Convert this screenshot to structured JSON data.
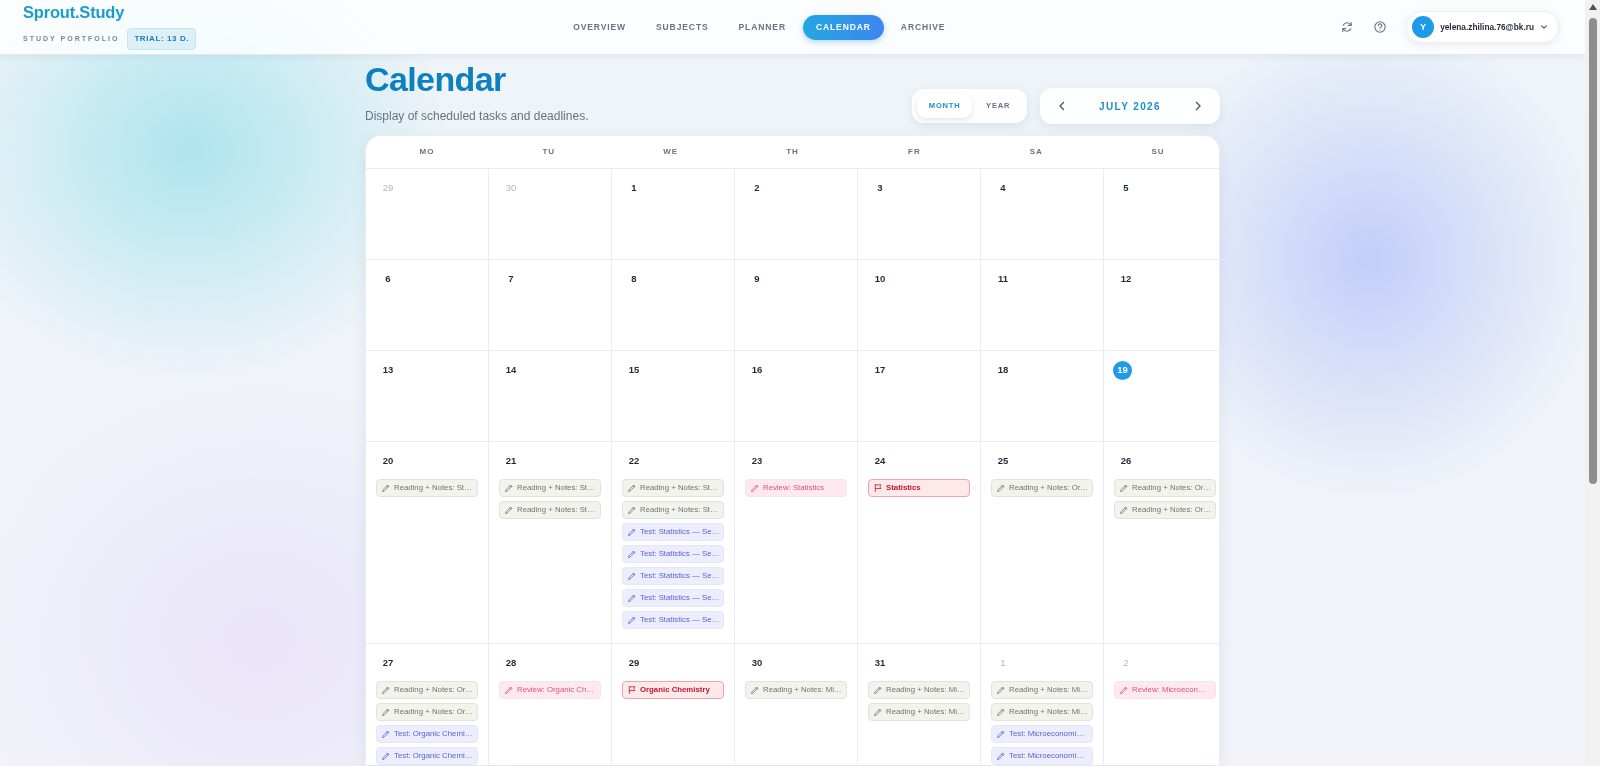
{
  "header": {
    "logo": "Sprout.Study",
    "tagline": "STUDY PORTFOLIO",
    "trial_badge": "TRIAL: 13 D.",
    "nav": [
      {
        "label": "OVERVIEW",
        "selected": false
      },
      {
        "label": "SUBJECTS",
        "selected": false
      },
      {
        "label": "PLANNER",
        "selected": false
      },
      {
        "label": "CALENDAR",
        "selected": true
      },
      {
        "label": "ARCHIVE",
        "selected": false
      }
    ],
    "user": {
      "initial": "Y",
      "email": "yelena.zhilina.76@bk.ru"
    }
  },
  "page": {
    "title": "Calendar",
    "subtitle": "Display of scheduled tasks and deadlines."
  },
  "view_toggle": [
    {
      "label": "MONTH",
      "selected": true
    },
    {
      "label": "YEAR",
      "selected": false
    }
  ],
  "month_nav": {
    "label": "JULY 2026"
  },
  "calendar": {
    "weekdays": [
      "MO",
      "TU",
      "WE",
      "TH",
      "FR",
      "SA",
      "SU"
    ],
    "weeks": [
      {
        "days": [
          {
            "day": "29",
            "outside": true,
            "today": false
          },
          {
            "day": "30",
            "outside": true,
            "today": false
          },
          {
            "day": "1",
            "outside": false,
            "today": false
          },
          {
            "day": "2",
            "outside": false,
            "today": false
          },
          {
            "day": "3",
            "outside": false,
            "today": false
          },
          {
            "day": "4",
            "outside": false,
            "today": false
          },
          {
            "day": "5",
            "outside": false,
            "today": false
          }
        ]
      },
      {
        "days": [
          {
            "day": "6",
            "outside": false,
            "today": false
          },
          {
            "day": "7",
            "outside": false,
            "today": false
          },
          {
            "day": "8",
            "outside": false,
            "today": false
          },
          {
            "day": "9",
            "outside": false,
            "today": false
          },
          {
            "day": "10",
            "outside": false,
            "today": false
          },
          {
            "day": "11",
            "outside": false,
            "today": false
          },
          {
            "day": "12",
            "outside": false,
            "today": false
          }
        ]
      },
      {
        "days": [
          {
            "day": "13",
            "outside": false,
            "today": false
          },
          {
            "day": "14",
            "outside": false,
            "today": false
          },
          {
            "day": "15",
            "outside": false,
            "today": false
          },
          {
            "day": "16",
            "outside": false,
            "today": false
          },
          {
            "day": "17",
            "outside": false,
            "today": false
          },
          {
            "day": "18",
            "outside": false,
            "today": false
          },
          {
            "day": "19",
            "outside": false,
            "today": true
          }
        ]
      },
      {
        "days": [
          {
            "day": "20",
            "outside": false,
            "today": false,
            "events": [
              {
                "kind": "study",
                "text": "Reading + Notes: St…"
              }
            ]
          },
          {
            "day": "21",
            "outside": false,
            "today": false,
            "events": [
              {
                "kind": "study",
                "text": "Reading + Notes: St…"
              },
              {
                "kind": "study",
                "text": "Reading + Notes: St…"
              }
            ]
          },
          {
            "day": "22",
            "outside": false,
            "today": false,
            "events": [
              {
                "kind": "study",
                "text": "Reading + Notes: St…"
              },
              {
                "kind": "study",
                "text": "Reading + Notes: St…"
              },
              {
                "kind": "test",
                "text": "Test: Statistics — Se…"
              },
              {
                "kind": "test",
                "text": "Test: Statistics — Se…"
              },
              {
                "kind": "test",
                "text": "Test: Statistics — Se…"
              },
              {
                "kind": "test",
                "text": "Test: Statistics — Se…"
              },
              {
                "kind": "test",
                "text": "Test: Statistics — Se…"
              }
            ]
          },
          {
            "day": "23",
            "outside": false,
            "today": false,
            "events": [
              {
                "kind": "review",
                "text": "Review: Statistics"
              }
            ]
          },
          {
            "day": "24",
            "outside": false,
            "today": false,
            "events": [
              {
                "kind": "deadline",
                "text": "Statistics"
              }
            ]
          },
          {
            "day": "25",
            "outside": false,
            "today": false,
            "events": [
              {
                "kind": "study",
                "text": "Reading + Notes: Or…"
              }
            ]
          },
          {
            "day": "26",
            "outside": false,
            "today": false,
            "events": [
              {
                "kind": "study",
                "text": "Reading + Notes: Or…"
              },
              {
                "kind": "study",
                "text": "Reading + Notes: Or…"
              }
            ]
          }
        ]
      },
      {
        "days": [
          {
            "day": "27",
            "outside": false,
            "today": false,
            "events": [
              {
                "kind": "study",
                "text": "Reading + Notes: Or…"
              },
              {
                "kind": "study",
                "text": "Reading + Notes: Or…"
              },
              {
                "kind": "test",
                "text": "Test: Organic Chemi…"
              },
              {
                "kind": "test",
                "text": "Test: Organic Chemi…"
              }
            ]
          },
          {
            "day": "28",
            "outside": false,
            "today": false,
            "events": [
              {
                "kind": "review",
                "text": "Review: Organic Ch…"
              }
            ]
          },
          {
            "day": "29",
            "outside": false,
            "today": false,
            "events": [
              {
                "kind": "deadline",
                "text": "Organic Chemistry"
              }
            ]
          },
          {
            "day": "30",
            "outside": false,
            "today": false,
            "events": [
              {
                "kind": "study",
                "text": "Reading + Notes: Mi…"
              }
            ]
          },
          {
            "day": "31",
            "outside": false,
            "today": false,
            "events": [
              {
                "kind": "study",
                "text": "Reading + Notes: Mi…"
              },
              {
                "kind": "study",
                "text": "Reading + Notes: Mi…"
              }
            ]
          },
          {
            "day": "1",
            "outside": true,
            "today": false,
            "events": [
              {
                "kind": "study",
                "text": "Reading + Notes: Mi…"
              },
              {
                "kind": "study",
                "text": "Reading + Notes: Mi…"
              },
              {
                "kind": "test",
                "text": "Test: Microeconomi…"
              },
              {
                "kind": "test",
                "text": "Test: Microeconomi…"
              }
            ]
          },
          {
            "day": "2",
            "outside": true,
            "today": false,
            "events": [
              {
                "kind": "review",
                "text": "Review: Microecon…"
              }
            ]
          }
        ]
      }
    ]
  }
}
